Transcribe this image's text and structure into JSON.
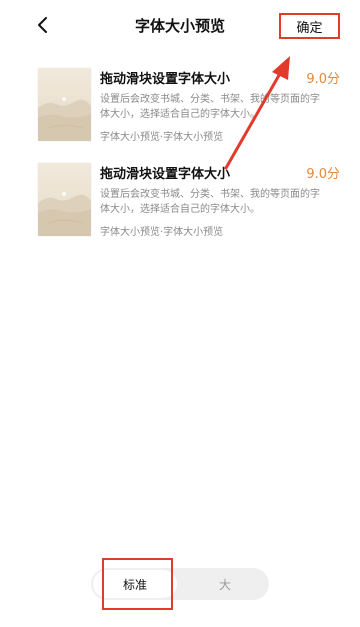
{
  "header": {
    "title": "字体大小预览",
    "confirm_label": "确定"
  },
  "books": [
    {
      "title": "拖动滑块设置字体大小",
      "score": "9.0分",
      "description": "设置后会改变书城、分类、书架、我的等页面的字体大小，选择适合自己的字体大小。",
      "tags": "字体大小预览·字体大小预览"
    },
    {
      "title": "拖动滑块设置字体大小",
      "score": "9.0分",
      "description": "设置后会改变书城、分类、书架、我的等页面的字体大小，选择适合自己的字体大小。",
      "tags": "字体大小预览·字体大小预览"
    }
  ],
  "font_size_switch": {
    "options": [
      "标准",
      "大"
    ],
    "selected": "标准"
  },
  "colors": {
    "score": "#e38a3a",
    "annotation": "#e23a2b"
  },
  "icons": [
    "back-arrow-icon"
  ]
}
